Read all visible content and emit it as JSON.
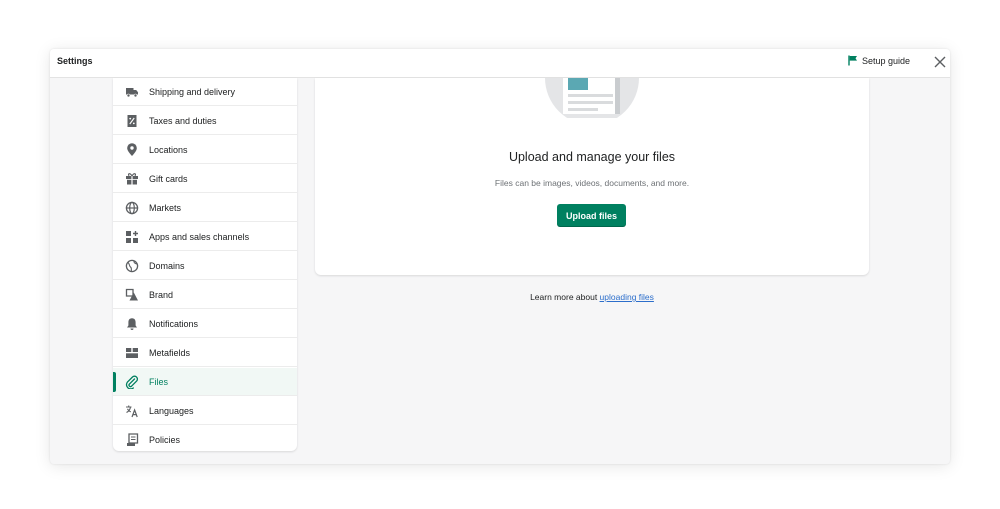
{
  "window": {
    "title": "Settings",
    "setup_guide_label": "Setup guide"
  },
  "sidebar": {
    "items": [
      {
        "label": "Shipping and delivery",
        "icon": "truck-icon"
      },
      {
        "label": "Taxes and duties",
        "icon": "tax-receipt-icon"
      },
      {
        "label": "Locations",
        "icon": "location-pin-icon"
      },
      {
        "label": "Gift cards",
        "icon": "gift-icon"
      },
      {
        "label": "Markets",
        "icon": "globe-icon"
      },
      {
        "label": "Apps and sales channels",
        "icon": "apps-icon"
      },
      {
        "label": "Domains",
        "icon": "domain-globe-icon"
      },
      {
        "label": "Brand",
        "icon": "brand-icon"
      },
      {
        "label": "Notifications",
        "icon": "bell-icon"
      },
      {
        "label": "Metafields",
        "icon": "metafields-icon"
      },
      {
        "label": "Files",
        "icon": "paperclip-icon",
        "active": true
      },
      {
        "label": "Languages",
        "icon": "translate-icon"
      },
      {
        "label": "Policies",
        "icon": "policy-document-icon"
      }
    ]
  },
  "main": {
    "heading": "Upload and manage your files",
    "subtext": "Files can be images, videos, documents, and more.",
    "upload_button": "Upload files",
    "learn_more_prefix": "Learn more about ",
    "learn_more_link": "uploading files"
  },
  "colors": {
    "primary": "#008060",
    "link": "#2c6ecb",
    "background": "#f6f6f7"
  }
}
